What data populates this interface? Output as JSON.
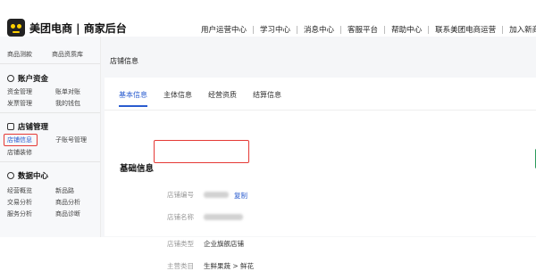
{
  "header": {
    "brand": "美团电商 | 商家后台",
    "nav": [
      "用户运营中心",
      "学习中心",
      "消息中心",
      "客服平台",
      "帮助中心",
      "联系美团电商运营",
      "加入新商家训"
    ]
  },
  "sidebar": {
    "top_items": [
      "商品测款",
      "商品资质库"
    ],
    "groups": [
      {
        "title": "账户资金",
        "items": [
          "资金管理",
          "账单对账",
          "发票管理",
          "我的钱包"
        ]
      },
      {
        "title": "店铺管理",
        "items": [
          "店铺信息",
          "子账号管理",
          "店铺装修"
        ]
      },
      {
        "title": "数据中心",
        "items": [
          "经营概览",
          "新品路",
          "交易分析",
          "商品分析",
          "服务分析",
          "商品诊断"
        ]
      }
    ]
  },
  "main": {
    "breadcrumb": "店铺信息",
    "tabs": [
      "基本信息",
      "主体信息",
      "经营资质",
      "结算信息"
    ],
    "active_tab": "基本信息",
    "section_title": "基础信息",
    "rows": [
      {
        "label": "店铺编号",
        "value": "",
        "action": "复制"
      },
      {
        "label": "店铺名称",
        "value": ""
      },
      {
        "label": "店铺类型",
        "value": "企业旗舰店铺"
      },
      {
        "label": "主营类目",
        "value": "生鲜果蔬 > 鲜花"
      }
    ]
  }
}
